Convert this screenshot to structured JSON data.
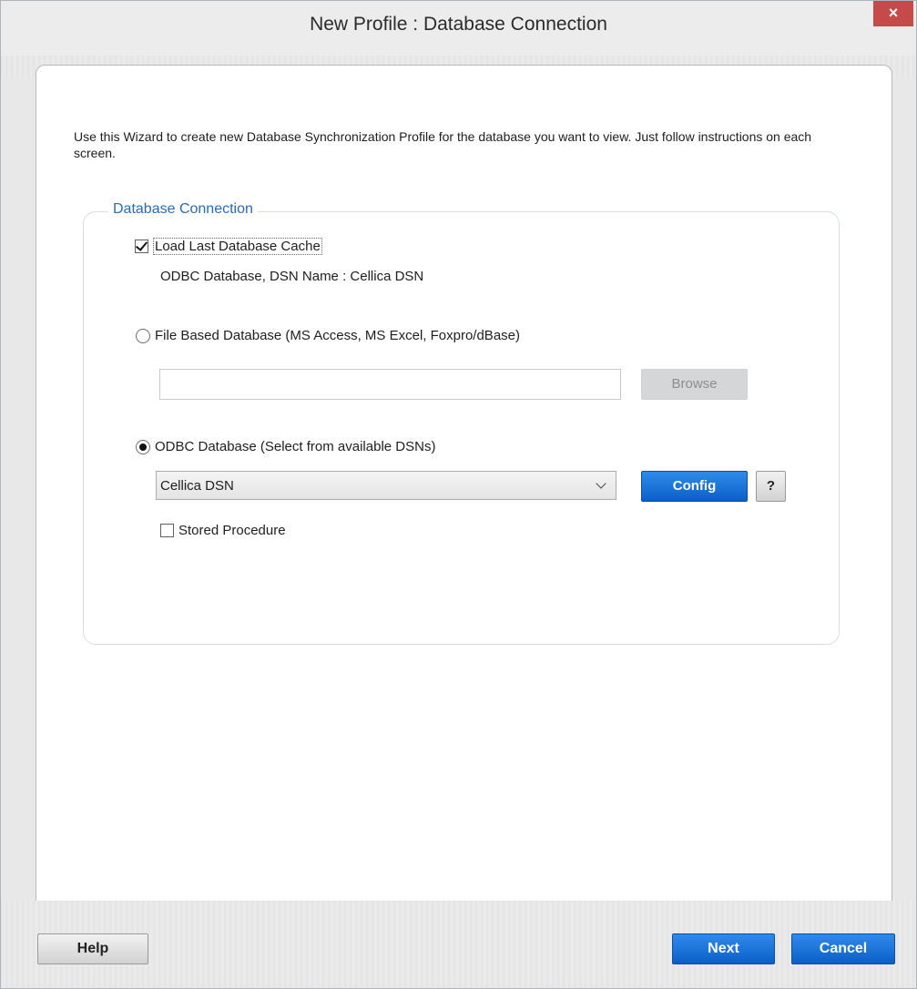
{
  "window": {
    "title": "New Profile : Database Connection",
    "close_label": "×"
  },
  "intro": "Use this Wizard to create new Database Synchronization Profile for the database you want to view. Just follow instructions on each screen.",
  "group": {
    "title": "Database Connection",
    "load_cache": {
      "label": "Load Last Database Cache",
      "checked": true
    },
    "cache_info": "ODBC Database, DSN Name : Cellica DSN",
    "file_based": {
      "label": "File Based Database (MS Access, MS Excel, Foxpro/dBase)",
      "selected": false,
      "path_value": "",
      "browse_label": "Browse"
    },
    "odbc": {
      "label": "ODBC Database (Select from available DSNs)",
      "selected": true,
      "dsn_selected": "Cellica DSN",
      "config_label": "Config",
      "help_label": "?",
      "stored_procedure": {
        "label": "Stored Procedure",
        "checked": false
      }
    }
  },
  "footer": {
    "help_label": "Help",
    "next_label": "Next",
    "cancel_label": "Cancel"
  },
  "colors": {
    "accent_blue": "#1a6fd8",
    "group_title": "#2a6ab5",
    "close_red": "#c74a4a"
  }
}
